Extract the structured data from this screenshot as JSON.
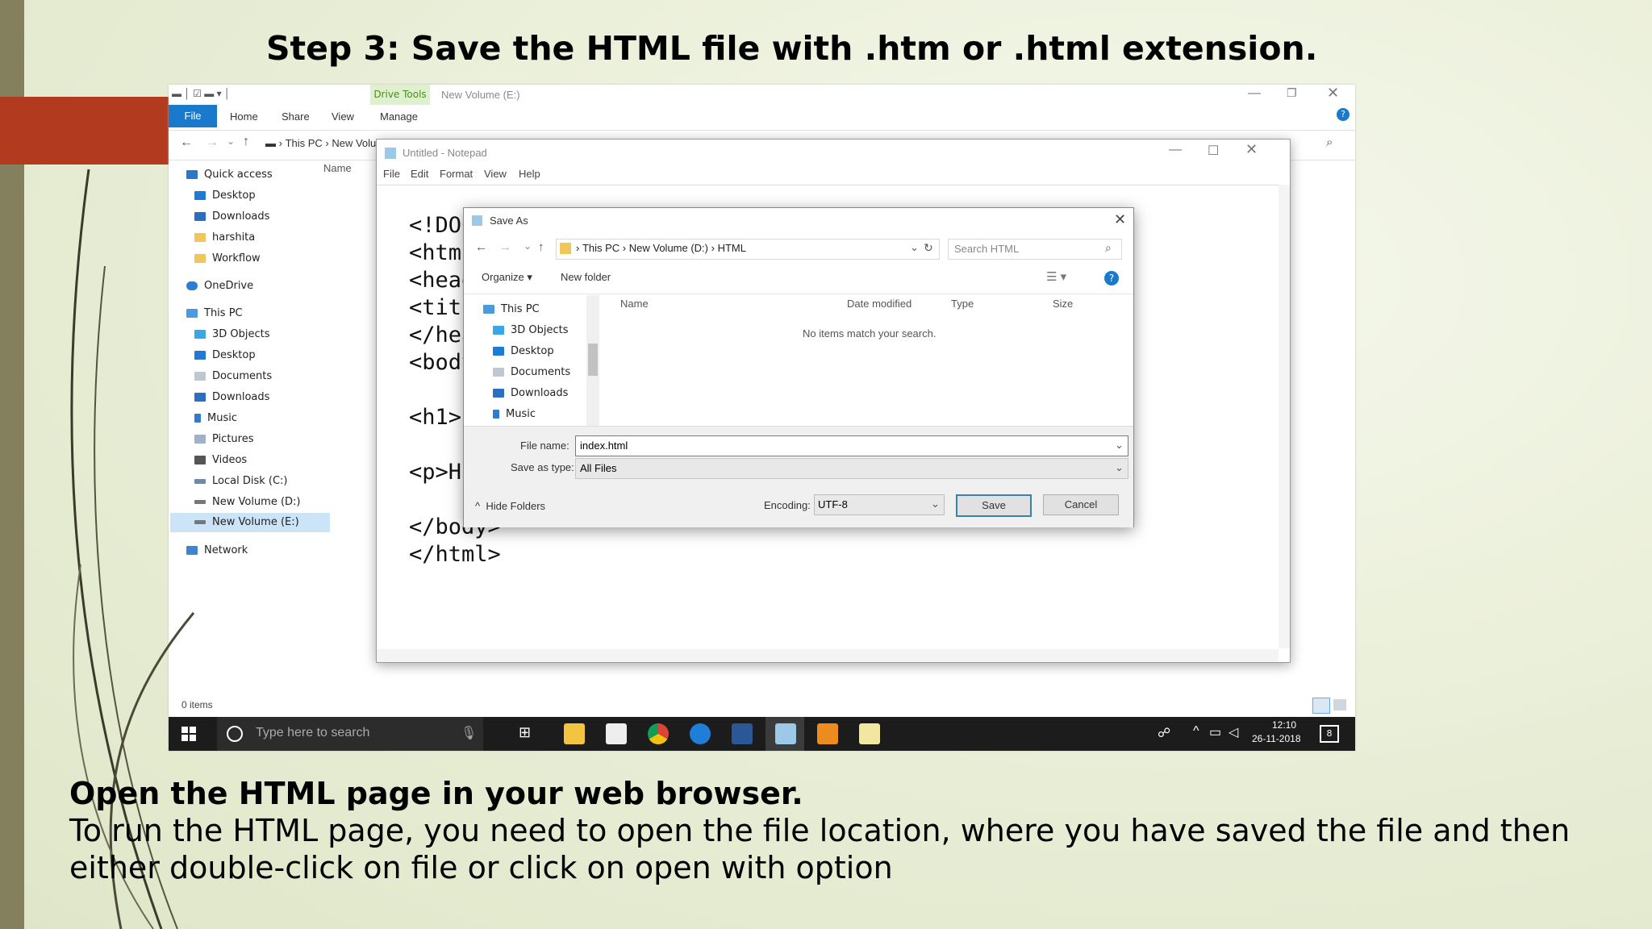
{
  "slide": {
    "title": "Step 3: Save the HTML file with .htm or .html extension.",
    "heading": "Open the HTML page in your web browser.",
    "body_line1": "To run the HTML page, you need to open the file location, where you have saved the file and then",
    "body_line2": "either double-click on file or click on open with option"
  },
  "explorer": {
    "title": "New Volume (E:)",
    "context_tab": "Drive Tools",
    "ribbon_tabs": [
      "File",
      "Home",
      "Share",
      "View",
      "Manage"
    ],
    "breadcrumb": [
      "This PC",
      "New Volume (E:)"
    ],
    "column_name": "Name",
    "nav": [
      "Quick access",
      "Desktop",
      "Downloads",
      "harshita",
      "Workflow",
      "OneDrive",
      "This PC",
      "3D Objects",
      "Desktop",
      "Documents",
      "Downloads",
      "Music",
      "Pictures",
      "Videos",
      "Local Disk (C:)",
      "New Volume (D:)",
      "New Volume (E:)",
      "Network"
    ],
    "status": "0 items"
  },
  "notepad": {
    "title": "Untitled - Notepad",
    "menu": [
      "File",
      "Edit",
      "Format",
      "View",
      "Help"
    ],
    "lines": [
      "<!DOC",
      "<html",
      "<head",
      "<titl",
      "</hea",
      "<body",
      "",
      "<h1>",
      "",
      "<p>H",
      "",
      "</body>",
      "</html>"
    ]
  },
  "save_as": {
    "title": "Save As",
    "path": [
      "This PC",
      "New Volume (D:)",
      "HTML"
    ],
    "search_placeholder": "Search HTML",
    "organize": "Organize",
    "new_folder": "New folder",
    "tree": [
      "This PC",
      "3D Objects",
      "Desktop",
      "Documents",
      "Downloads",
      "Music"
    ],
    "columns": [
      "Name",
      "Date modified",
      "Type",
      "Size"
    ],
    "empty_message": "No items match your search.",
    "file_name_label": "File name:",
    "file_name_value": "index.html",
    "save_type_label": "Save as type:",
    "save_type_value": "All Files",
    "hide_folders": "Hide Folders",
    "encoding_label": "Encoding:",
    "encoding_value": "UTF-8",
    "save": "Save",
    "cancel": "Cancel"
  },
  "taskbar": {
    "search_placeholder": "Type here to search",
    "time": "12:10",
    "date": "26-11-2018",
    "notification_count": "8"
  }
}
